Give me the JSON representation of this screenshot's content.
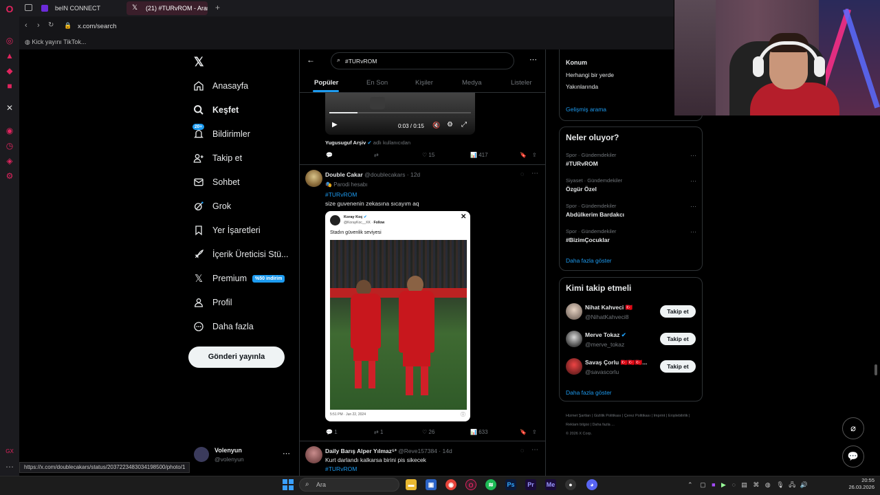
{
  "browser": {
    "tabs": [
      {
        "label": "beIN CONNECT"
      },
      {
        "label": "(21) #TURvROM - Arama /"
      }
    ],
    "url": "x.com/search",
    "bookmark": "Kick yayını TikTok...",
    "status_url": "https://x.com/doublecakars/status/2037223483034198500/photo/1"
  },
  "nav": {
    "items": [
      {
        "label": "Anasayfa",
        "icon": "home-icon"
      },
      {
        "label": "Keşfet",
        "icon": "search-icon"
      },
      {
        "label": "Bildirimler",
        "icon": "bell-icon",
        "badge": "20+"
      },
      {
        "label": "Takip et",
        "icon": "add-person-icon"
      },
      {
        "label": "Sohbet",
        "icon": "mail-icon"
      },
      {
        "label": "Grok",
        "icon": "grok-icon"
      },
      {
        "label": "Yer İşaretleri",
        "icon": "bookmark-icon"
      },
      {
        "label": "İçerik Üreticisi Stü...",
        "icon": "rocket-icon"
      },
      {
        "label": "Premium",
        "icon": "x-logo-icon",
        "badge": "%50 indirim"
      },
      {
        "label": "Profil",
        "icon": "person-icon"
      },
      {
        "label": "Daha fazla",
        "icon": "more-circle-icon"
      }
    ],
    "post_button": "Gönderi yayınla",
    "account": {
      "name": "Volenyun",
      "handle": "@volenyun"
    }
  },
  "search": {
    "query": "#TURvROM",
    "tabs": [
      "Popüler",
      "En Son",
      "Kişiler",
      "Medya",
      "Listeler"
    ],
    "active_tab": "Popüler"
  },
  "video": {
    "time": "0:03 / 0:15",
    "attribution_name": "Yugusuguf Arşiv",
    "attribution_suffix": "adlı kullanıcıdan",
    "progress": 0.2,
    "stats": {
      "replies": "",
      "reposts": "",
      "likes": "15",
      "views": "417"
    }
  },
  "tweet1": {
    "name": "Double Cakar",
    "handle": "@doublecakars",
    "time": "12d",
    "label": "Parodi hesabı",
    "hashtag": "#TURvROM",
    "text": "size guvenenin zekasına sıcayım aq",
    "embed": {
      "name": "Koray Koç",
      "handle": "@KorayKoc__KK",
      "follow": "Follow",
      "text": "Stadın güvenlik seviyesi",
      "footer": "5:51 PM · Jun 22, 2024"
    },
    "stats": {
      "replies": "1",
      "reposts": "1",
      "likes": "26",
      "views": "633"
    }
  },
  "tweet2": {
    "name": "Daily Barış Alper Yılmaz⁵³",
    "handle": "@Reve157384",
    "time": "14d",
    "text": "Kurt darlandı kalkarsa birini pis sikecek",
    "hashtag": "#TURvROM"
  },
  "location": {
    "title": "Konum",
    "options": [
      "Herhangi bir yerde",
      "Yakınlarında"
    ],
    "advanced": "Gelişmiş arama"
  },
  "trends": {
    "title": "Neler oluyor?",
    "items": [
      {
        "context": "Spor · Gündemdekiler",
        "name": "#TURvROM"
      },
      {
        "context": "Siyaset · Gündemdekiler",
        "name": "Özgür Özel"
      },
      {
        "context": "Spor · Gündemdekiler",
        "name": "Abdülkerim Bardakcı"
      },
      {
        "context": "Spor · Gündemdekiler",
        "name": "#BizimÇocuklar"
      }
    ],
    "more": "Daha fazla göster"
  },
  "who_to_follow": {
    "title": "Kimi takip etmeli",
    "users": [
      {
        "name": "Nihat Kahveci 🇹🇷",
        "handle": "@NihatKahveci8"
      },
      {
        "name": "Merve Tokaz",
        "handle": "@merve_tokaz"
      },
      {
        "name": "Savaş Çorlu 🇹🇷🇹🇷🇹🇷...",
        "handle": "@savascorlu"
      }
    ],
    "follow_label": "Takip et",
    "more": "Daha fazla göster"
  },
  "footer_links": [
    "Hizmet Şartları",
    "Gizlilik Politikası",
    "Çerez Politikası",
    "Imprint",
    "Erişilebilirlik",
    "Reklam bilgisi",
    "Daha fazla ...",
    "© 2026 X Corp."
  ],
  "taskbar": {
    "search_placeholder": "Ara",
    "time": "20:55",
    "date": "26.03.2026"
  },
  "colors": {
    "accent": "#1d9bf0",
    "background": "#000000",
    "border": "#2f3336",
    "opera": "#e0245e"
  }
}
